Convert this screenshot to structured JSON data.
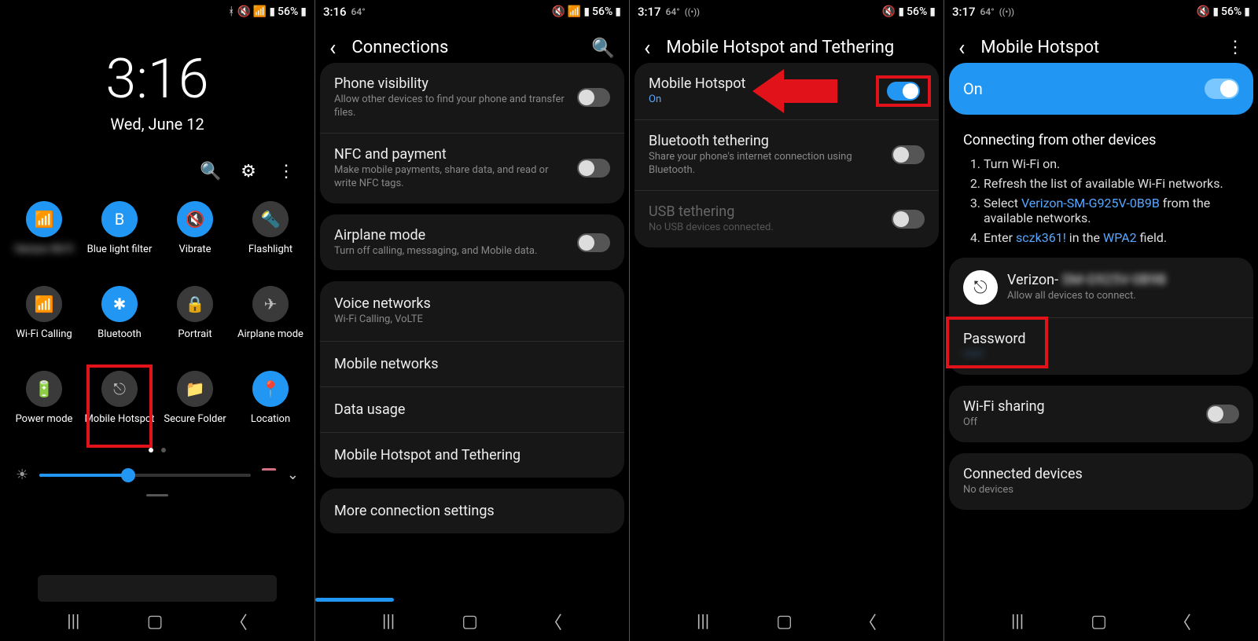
{
  "p1": {
    "status": {
      "time": "",
      "temp": "",
      "battery": "56%"
    },
    "clock": "3:16",
    "date": "Wed, June 12",
    "tiles": [
      {
        "label": " ",
        "glyph": "📶",
        "on": true
      },
      {
        "label": "Blue light filter",
        "glyph": "B",
        "on": true
      },
      {
        "label": "Vibrate",
        "glyph": "🔇",
        "on": true
      },
      {
        "label": "Flashlight",
        "glyph": "🔦",
        "on": false
      },
      {
        "label": "Wi-Fi Calling",
        "glyph": "📶",
        "on": false
      },
      {
        "label": "Bluetooth",
        "glyph": "✱",
        "on": true
      },
      {
        "label": "Portrait",
        "glyph": "🔒",
        "on": false
      },
      {
        "label": "Airplane mode",
        "glyph": "✈",
        "on": false
      },
      {
        "label": "Power mode",
        "glyph": "🔋",
        "on": false
      },
      {
        "label": "Mobile Hotspot",
        "glyph": "⎋",
        "on": false,
        "highlight": true
      },
      {
        "label": "Secure Folder",
        "glyph": "📁",
        "on": false
      },
      {
        "label": "Location",
        "glyph": "📍",
        "on": true
      }
    ]
  },
  "p2": {
    "status": {
      "time": "3:16",
      "temp": "64°",
      "battery": "56%"
    },
    "title": "Connections",
    "groups": [
      [
        {
          "title": "Phone visibility",
          "sub": "Allow other devices to find your phone and transfer files.",
          "toggle": false
        },
        {
          "title": "NFC and payment",
          "sub": "Make mobile payments, share data, and read or write NFC tags.",
          "toggle": false
        }
      ],
      [
        {
          "title": "Airplane mode",
          "sub": "Turn off calling, messaging, and Mobile data.",
          "toggle": false
        }
      ],
      [
        {
          "title": "Voice networks",
          "sub": "Wi-Fi Calling, VoLTE"
        },
        {
          "title": "Mobile networks"
        },
        {
          "title": "Data usage"
        },
        {
          "title": "Mobile Hotspot and Tethering",
          "arrow": true
        }
      ],
      [
        {
          "title": "More connection settings"
        }
      ]
    ]
  },
  "p3": {
    "status": {
      "time": "3:17",
      "temp": "64°",
      "extra": "((•))",
      "battery": "56%"
    },
    "title": "Mobile Hotspot and Tethering",
    "items": [
      {
        "title": "Mobile Hotspot",
        "sub": "On",
        "subBlue": true,
        "toggle": true,
        "highlight": true,
        "arrow": true
      },
      {
        "title": "Bluetooth tethering",
        "sub": "Share your phone's internet connection using Bluetooth.",
        "toggle": false
      },
      {
        "title": "USB tethering",
        "sub": "No USB devices connected.",
        "toggle": false,
        "disabled": true
      }
    ]
  },
  "p4": {
    "status": {
      "time": "3:17",
      "temp": "64°",
      "extra": "((•))",
      "battery": "56%"
    },
    "title": "Mobile Hotspot",
    "masterToggle": "On",
    "instrTitle": "Connecting from other devices",
    "instructions": [
      "Turn Wi-Fi on.",
      "Refresh the list of available Wi-Fi networks.",
      {
        "pre": "Select ",
        "link": "Verizon-SM-G925V-0B9B",
        "post": " from the available networks."
      },
      {
        "pre": "Enter ",
        "link": "sczk361!",
        "mid": " in the ",
        "link2": "WPA2",
        "post": " field."
      }
    ],
    "hotspot": {
      "name": "Verizon- ",
      "sub": "Allow all devices to connect."
    },
    "password": {
      "label": "Password",
      "value": "••••••"
    },
    "wifiSharing": {
      "label": "Wi-Fi sharing",
      "sub": "Off",
      "on": false
    },
    "connected": {
      "label": "Connected devices",
      "sub": "No devices"
    }
  }
}
